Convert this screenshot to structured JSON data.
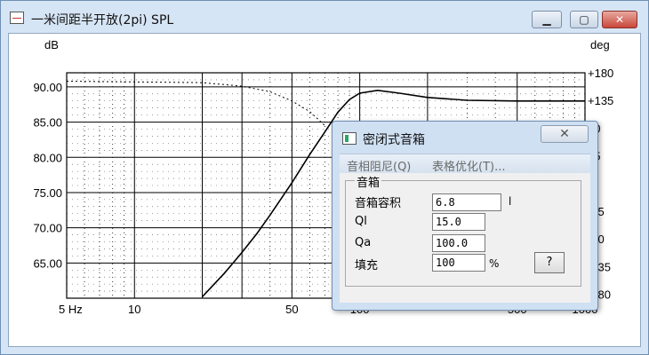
{
  "window": {
    "title": "一米间距半开放(2pi) SPL",
    "minimize_label": "▁",
    "maximize_label": "▢",
    "close_label": "✕"
  },
  "chart_data": {
    "type": "line",
    "ylabel_left": "dB",
    "ylabel_right": "deg",
    "x_scale": "log",
    "xlim": [
      5,
      1000
    ],
    "ylim": [
      60,
      92
    ],
    "y2lim": [
      -180,
      180
    ],
    "xtick_labels": [
      "5 Hz",
      "10",
      "50",
      "100",
      "500",
      "1000"
    ],
    "ytick_labels": [
      "90.00",
      "85.00",
      "80.00",
      "75.00",
      "70.00",
      "65.00"
    ],
    "y2tick_labels": [
      "+180",
      "+135",
      "90",
      "45",
      "0",
      "-45",
      "-90",
      "-135",
      "-180"
    ],
    "grid": true,
    "series": [
      {
        "style": "solid",
        "points": [
          [
            20,
            60.2
          ],
          [
            25,
            63.5
          ],
          [
            30,
            66.5
          ],
          [
            35,
            69.2
          ],
          [
            40,
            71.8
          ],
          [
            50,
            76.4
          ],
          [
            60,
            80.4
          ],
          [
            70,
            83.6
          ],
          [
            80,
            86.4
          ],
          [
            90,
            88.2
          ],
          [
            100,
            89.1
          ],
          [
            120,
            89.5
          ],
          [
            150,
            89.1
          ],
          [
            200,
            88.5
          ],
          [
            300,
            88.1
          ],
          [
            500,
            88.0
          ],
          [
            1000,
            88.0
          ]
        ]
      },
      {
        "style": "dotted",
        "points": [
          [
            5,
            90.8
          ],
          [
            10,
            90.7
          ],
          [
            20,
            90.6
          ],
          [
            30,
            90.1
          ],
          [
            40,
            89.3
          ],
          [
            50,
            88.0
          ],
          [
            60,
            86.5
          ],
          [
            70,
            84.5
          ]
        ]
      }
    ]
  },
  "dialog": {
    "title": "密闭式音箱",
    "close_label": "✕",
    "menu": [
      "音相阻尼(Q)",
      "表格优化(T)..."
    ],
    "group_title": "音箱",
    "fields": [
      {
        "label": "音箱容积",
        "value": "6.8",
        "unit": "l"
      },
      {
        "label": "Ql",
        "value": "15.0",
        "unit": ""
      },
      {
        "label": "Qa",
        "value": "100.0",
        "unit": ""
      },
      {
        "label": "填充",
        "value": "100",
        "unit": "%"
      }
    ],
    "help_label": "?"
  }
}
